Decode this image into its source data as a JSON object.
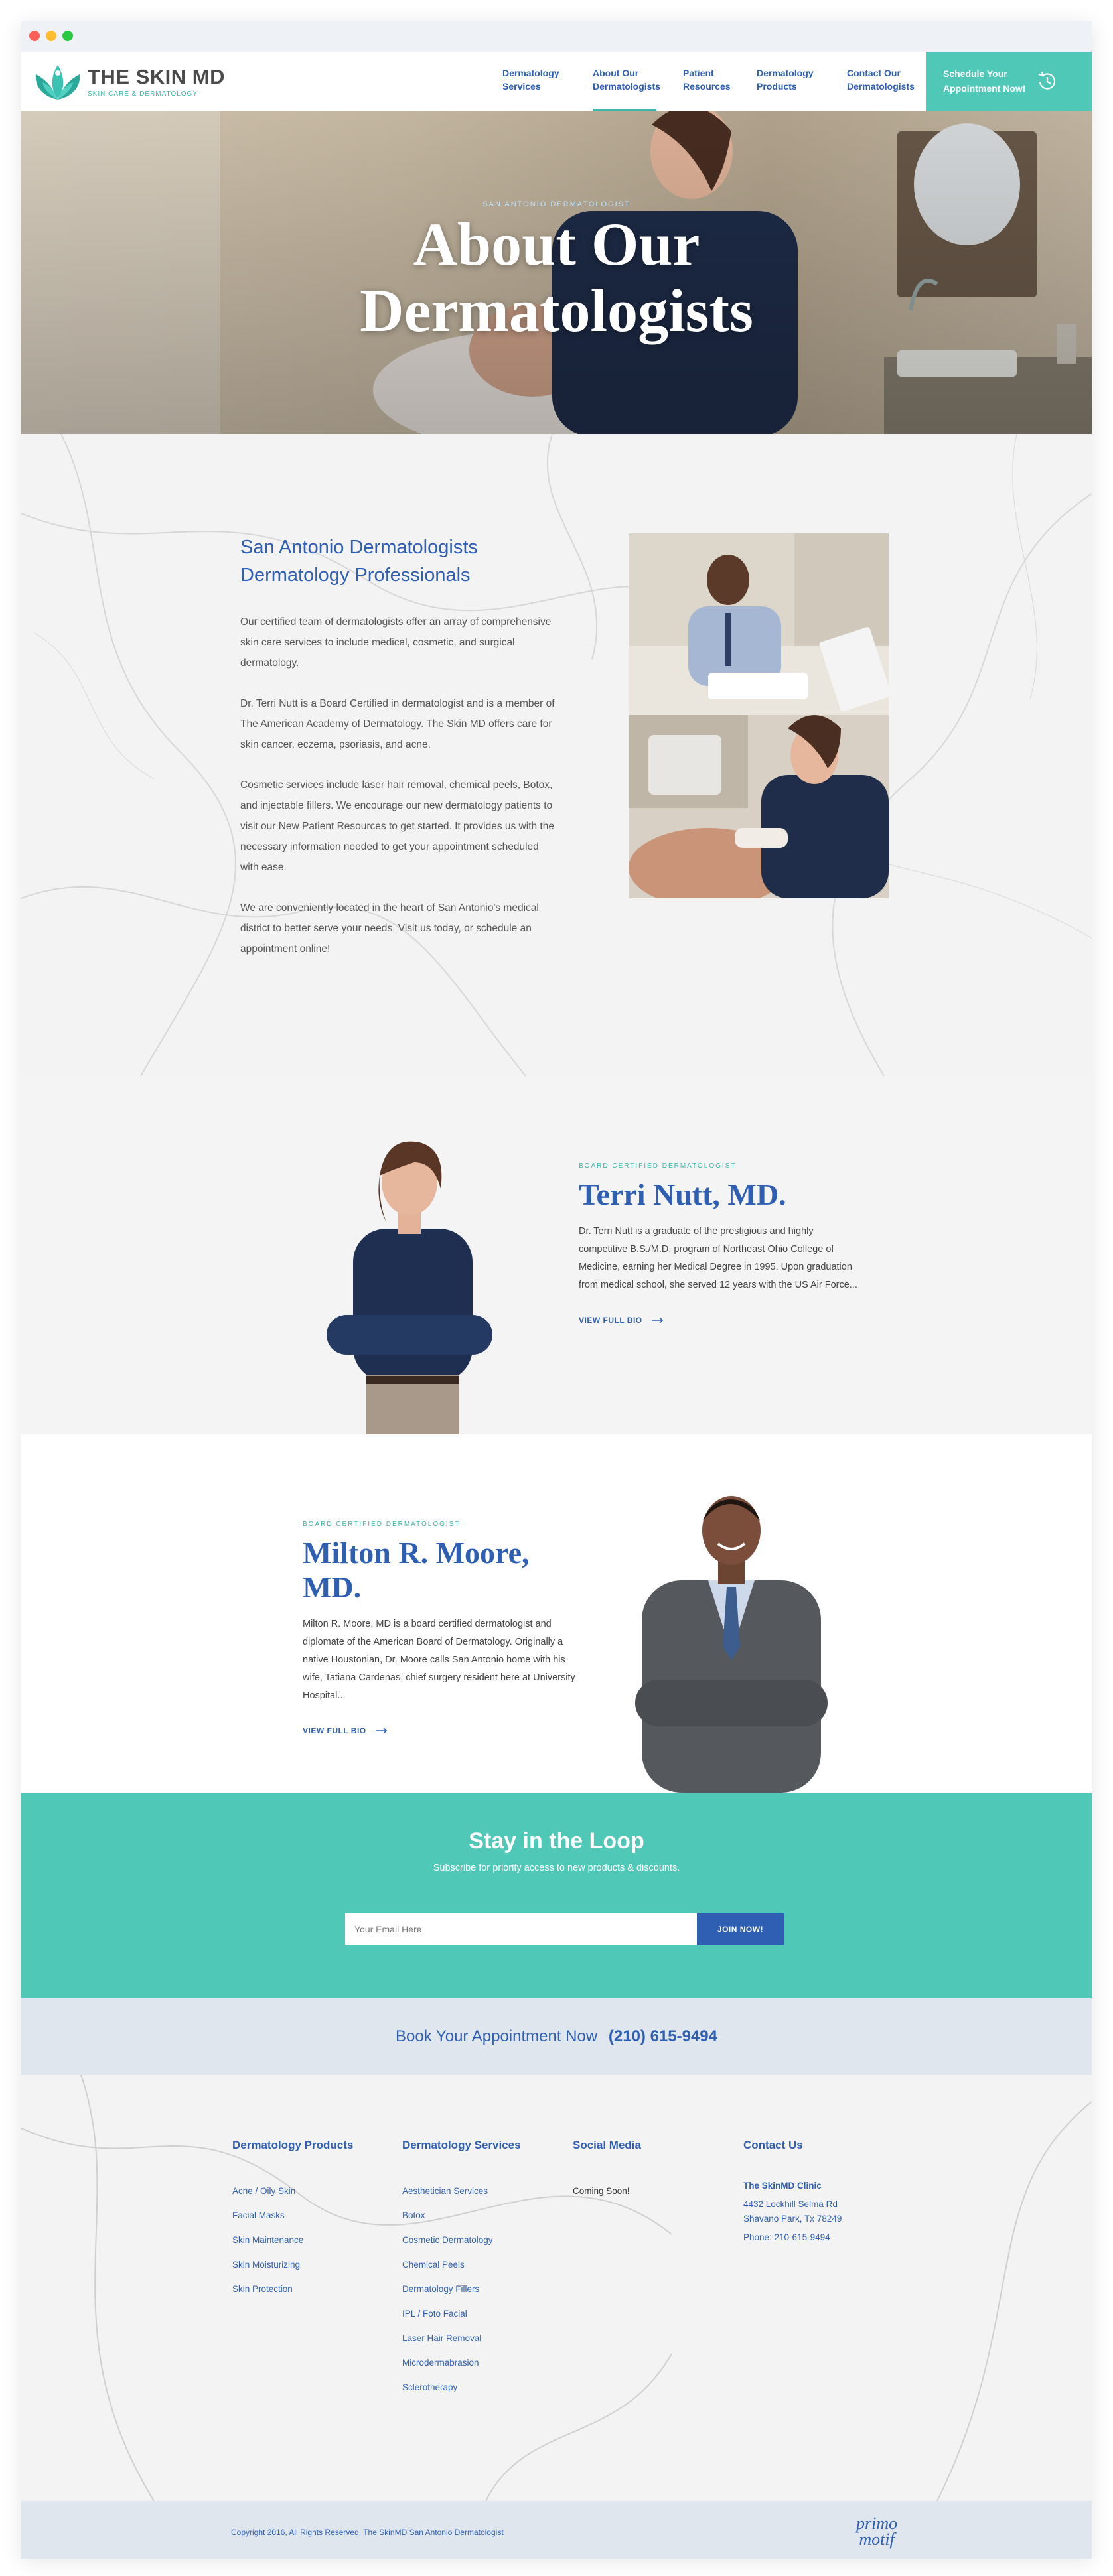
{
  "brand": {
    "name": "THE SKIN MD",
    "tagline": "SKIN CARE & DERMATOLOGY",
    "colors": {
      "teal": "#4fc8b8",
      "blue": "#2f5fb3"
    }
  },
  "nav": {
    "items": [
      {
        "label_line1": "Dermatology",
        "label_line2": "Services"
      },
      {
        "label_line1": "About Our",
        "label_line2": "Dermatologists"
      },
      {
        "label_line1": "Patient",
        "label_line2": "Resources"
      },
      {
        "label_line1": "Dermatology",
        "label_line2": "Products"
      },
      {
        "label_line1": "Contact Our",
        "label_line2": "Dermatologists"
      }
    ],
    "active_index": 1,
    "cta": {
      "line1": "Schedule Your",
      "line2": "Appointment Now!",
      "icon": "clock-history-icon"
    }
  },
  "hero": {
    "eyebrow": "SAN ANTONIO DERMATOLOGIST",
    "title_line1": "About Our",
    "title_line2": "Dermatologists"
  },
  "intro": {
    "heading_line1": "San Antonio Dermatologists",
    "heading_line2": "Dermatology Professionals",
    "paragraphs": [
      "Our certified team of dermatologists offer an array of comprehensive skin care services to include medical, cosmetic, and surgical dermatology.",
      "Dr. Terri Nutt is a Board Certified in dermatologist and is a member of The American Academy of Dermatology. The Skin MD offers care for skin cancer, eczema, psoriasis, and acne.",
      "Cosmetic services include laser hair removal, chemical peels, Botox, and injectable fillers. We encourage our new dermatology patients to visit our New Patient Resources to get started. It provides us with the necessary information needed to get your appointment scheduled with ease.",
      "We are conveniently located in the heart of San Antonio's medical district to better serve your needs. Visit us today, or schedule an appointment online!"
    ]
  },
  "doctors": [
    {
      "eyebrow": "BOARD CERTIFIED DERMATOLOGIST",
      "name_line1": "Terri Nutt, MD.",
      "name_line2": "",
      "bio": "Dr. Terri Nutt is a graduate of the prestigious and highly competitive B.S./M.D. program of Northeast Ohio College of Medicine, earning her Medical Degree in 1995. Upon graduation from medical school, she served 12 years with the US Air Force...",
      "link": "VIEW FULL BIO"
    },
    {
      "eyebrow": "BOARD CERTIFIED DERMATOLOGIST",
      "name_line1": "Milton R. Moore,",
      "name_line2": "MD.",
      "bio": "Milton R. Moore, MD is a board certified dermatologist and diplomate of the American Board of Dermatology. Originally a native Houstonian, Dr. Moore calls San Antonio home with his wife, Tatiana Cardenas, chief surgery resident here at University Hospital...",
      "link": "VIEW FULL BIO"
    }
  ],
  "newsletter": {
    "title": "Stay in the Loop",
    "subtitle": "Subscribe for priority access to new products & discounts.",
    "placeholder": "Your Email Here",
    "button": "JOIN NOW!"
  },
  "appointment": {
    "text": "Book Your Appointment Now",
    "phone": "(210) 615-9494"
  },
  "footer": {
    "products": {
      "title": "Dermatology Products",
      "items": [
        "Acne / Oily Skin",
        "Facial Masks",
        "Skin Maintenance",
        "Skin Moisturizing",
        "Skin Protection"
      ]
    },
    "services": {
      "title": "Dermatology Services",
      "items": [
        "Aesthetician Services",
        "Botox",
        "Cosmetic Dermatology",
        "Chemical Peels",
        "Dermatology Fillers",
        "IPL / Foto Facial",
        "Laser Hair Removal",
        "Microdermabrasion",
        "Sclerotherapy"
      ]
    },
    "social": {
      "title": "Social Media",
      "text": "Coming Soon!"
    },
    "contact": {
      "title": "Contact Us",
      "clinic": "The SkinMD Clinic",
      "address1": "4432 Lockhill Selma Rd",
      "address2": "Shavano Park, Tx 78249",
      "phone": "Phone: 210-615-9494"
    },
    "copyright": "Copyright 2016, All Rights Reserved. The SkinMD San Antonio Dermatologist",
    "credit_line1": "primo",
    "credit_line2": "motif"
  }
}
